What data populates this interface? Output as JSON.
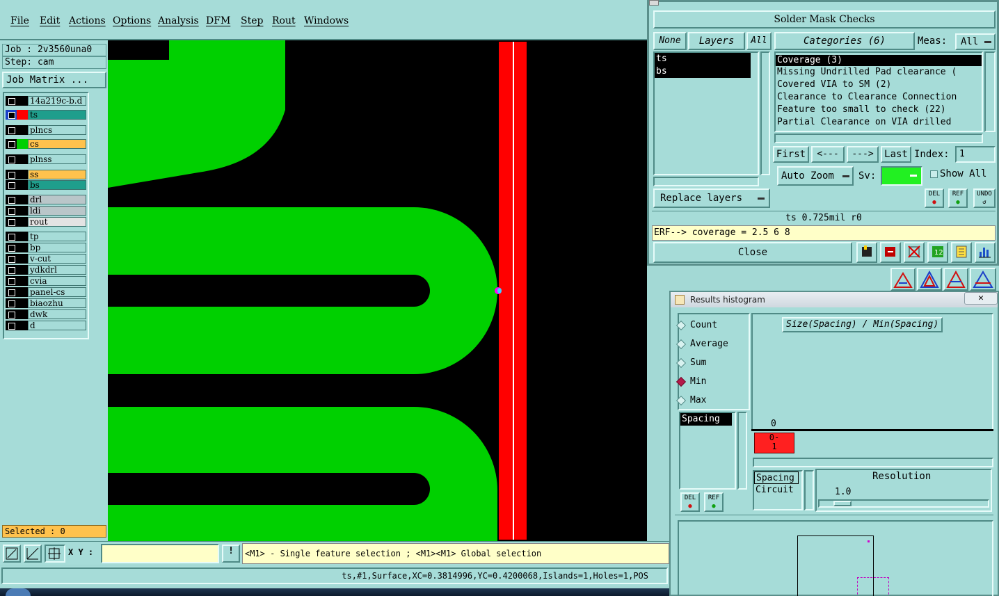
{
  "menu": [
    "File",
    "Edit",
    "Actions",
    "Options",
    "Analysis",
    "DFM",
    "Step",
    "Rout",
    "Windows"
  ],
  "job": {
    "job_line": "Job : 2v3560una0",
    "step_line": "Step: cam",
    "matrix_button": "Job Matrix ..."
  },
  "layers": [
    {
      "name": "14a219c-b.d",
      "color": "#000000",
      "row_bg": "#a6dcd8"
    },
    {
      "name": "ts",
      "color": "#ff0000",
      "row_bg": "#1f9e8c"
    },
    {
      "name": "plncs",
      "color": "#000000",
      "row_bg": "#a6dcd8"
    },
    {
      "name": "cs",
      "color": "#00d000",
      "row_bg": "#ffc24d"
    },
    {
      "name": "plnss",
      "color": "#000000",
      "row_bg": "#a6dcd8"
    },
    {
      "name": "ss",
      "color": "#000000",
      "row_bg": "#ffc24d"
    },
    {
      "name": "bs",
      "color": "#000000",
      "row_bg": "#1f9e8c"
    },
    {
      "name": "drl",
      "color": "#000000",
      "row_bg": "#b9c6c9"
    },
    {
      "name": "ldi",
      "color": "#000000",
      "row_bg": "#b9c6c9"
    },
    {
      "name": "rout",
      "color": "#000000",
      "row_bg": "#e3e3e3"
    },
    {
      "name": "tp",
      "color": "#000000",
      "row_bg": "#a6dcd8"
    },
    {
      "name": "bp",
      "color": "#000000",
      "row_bg": "#a6dcd8"
    },
    {
      "name": "v-cut",
      "color": "#000000",
      "row_bg": "#a6dcd8"
    },
    {
      "name": "ydkdrl",
      "color": "#000000",
      "row_bg": "#a6dcd8"
    },
    {
      "name": "cvia",
      "color": "#000000",
      "row_bg": "#a6dcd8"
    },
    {
      "name": "panel-cs",
      "color": "#000000",
      "row_bg": "#a6dcd8"
    },
    {
      "name": "biaozhu",
      "color": "#000000",
      "row_bg": "#a6dcd8"
    },
    {
      "name": "dwk",
      "color": "#000000",
      "row_bg": "#a6dcd8"
    },
    {
      "name": "d",
      "color": "#000000",
      "row_bg": "#a6dcd8"
    }
  ],
  "selected_label": "Selected : 0",
  "toolbar": {
    "xy_label": "X Y :",
    "xy_value": "",
    "hint": "<M1> - Single feature selection ; <M1><M1> Global selection"
  },
  "status_line": "ts,#1,Surface,XC=0.3814996,YC=0.4200068,Islands=1,Holes=1,POS",
  "solder_mask": {
    "title": "Solder Mask Checks",
    "none_btn": "None",
    "layers_btn": "Layers",
    "all_btn": "All",
    "categories_btn": "Categories (6)",
    "meas_label": "Meas:",
    "meas_value": "All",
    "layer_list": [
      "ts",
      "bs"
    ],
    "categories": [
      "Coverage (3)",
      "Missing Undrilled Pad clearance (",
      "Covered VIA to SM (2)",
      "Clearance to Clearance Connection",
      "Feature too small to check (22)",
      "Partial Clearance on VIA drilled"
    ],
    "first_btn": "First",
    "prev_btn": "<---",
    "next_btn": "--->",
    "last_btn": "Last",
    "index_label": "Index:",
    "index_value": "1",
    "autozoom_btn": "Auto Zoom",
    "sv_label": "Sv:",
    "show_all_label": "Show All",
    "replace_btn": "Replace layers",
    "del_label": "DEL",
    "ref_label": "REF",
    "undo_label": "UNDO",
    "info_line": "ts 0.725mil  r0",
    "erf_line": "ERF--> coverage = 2.5 6 8",
    "close_btn": "Close"
  },
  "histogram": {
    "title": "Results histogram",
    "modes": [
      "Count",
      "Average",
      "Sum",
      "Min",
      "Max"
    ],
    "selected_mode": "Min",
    "attr_list": [
      "Spacing"
    ],
    "header": "Size(Spacing) / Min(Spacing)",
    "bin_value": "0",
    "bin_label": "0-\n1",
    "type_list": [
      "Spacing",
      "Circuit"
    ],
    "resolution_label": "Resolution",
    "resolution_value": "1.0",
    "del_label": "DEL",
    "ref_label": "REF"
  },
  "colors": {
    "teal_panel": "#a6dcd8",
    "copper_green": "#00d000",
    "mask_red": "#ff0000",
    "canvas_bg": "#000000",
    "highlight_yellow": "#ffffc8"
  }
}
